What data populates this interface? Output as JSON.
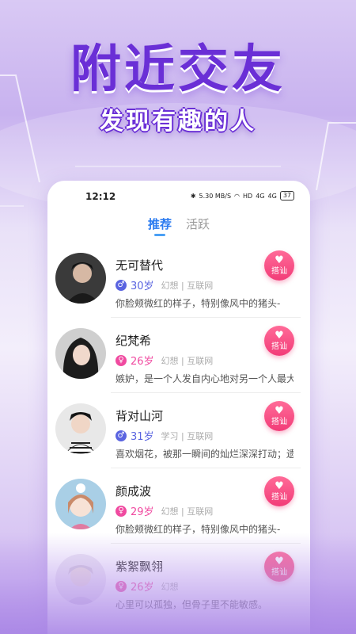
{
  "hero": {
    "title": "附近交友",
    "subtitle": "发现有趣的人"
  },
  "status_bar": {
    "time": "12:12",
    "speed": "5.30 MB/S",
    "hd": "HD",
    "signal1": "4G",
    "signal2": "4G",
    "battery": "37"
  },
  "tabs": [
    {
      "label": "推荐",
      "active": true
    },
    {
      "label": "活跃",
      "active": false
    }
  ],
  "users": [
    {
      "name": "无可替代",
      "gender": "male",
      "gender_symbol": "♂",
      "age": "30岁",
      "tags": "幻想 | 互联网",
      "bio": "你脸颊微红的样子，特别像风中的猪头-",
      "greet_label": "搭讪"
    },
    {
      "name": "纪梵希",
      "gender": "female",
      "gender_symbol": "♀",
      "age": "26岁",
      "tags": "幻想 | 互联网",
      "bio": "嫉妒，是一个人发自内心地对另一个人最大的…",
      "greet_label": "搭讪"
    },
    {
      "name": "背对山河",
      "gender": "male",
      "gender_symbol": "♂",
      "age": "31岁",
      "tags": "学习 | 互联网",
      "bio": "喜欢烟花，被那一瞬间的灿烂深深打动；遗憾…",
      "greet_label": "搭讪"
    },
    {
      "name": "颜成波",
      "gender": "female",
      "gender_symbol": "♀",
      "age": "29岁",
      "tags": "幻想 | 互联网",
      "bio": "你脸颊微红的样子，特别像风中的猪头-",
      "greet_label": "搭讪"
    },
    {
      "name": "紫絮飘翎",
      "gender": "female",
      "gender_symbol": "♀",
      "age": "26岁",
      "tags": "幻想",
      "bio": "心里可以孤独，但骨子里不能敏感。",
      "greet_label": "搭讪"
    }
  ],
  "colors": {
    "accent": "#6a2fd6",
    "tab_active": "#2d7cf0",
    "male": "#5a64e0",
    "female": "#f04aa0",
    "greet": "#f23c78"
  }
}
